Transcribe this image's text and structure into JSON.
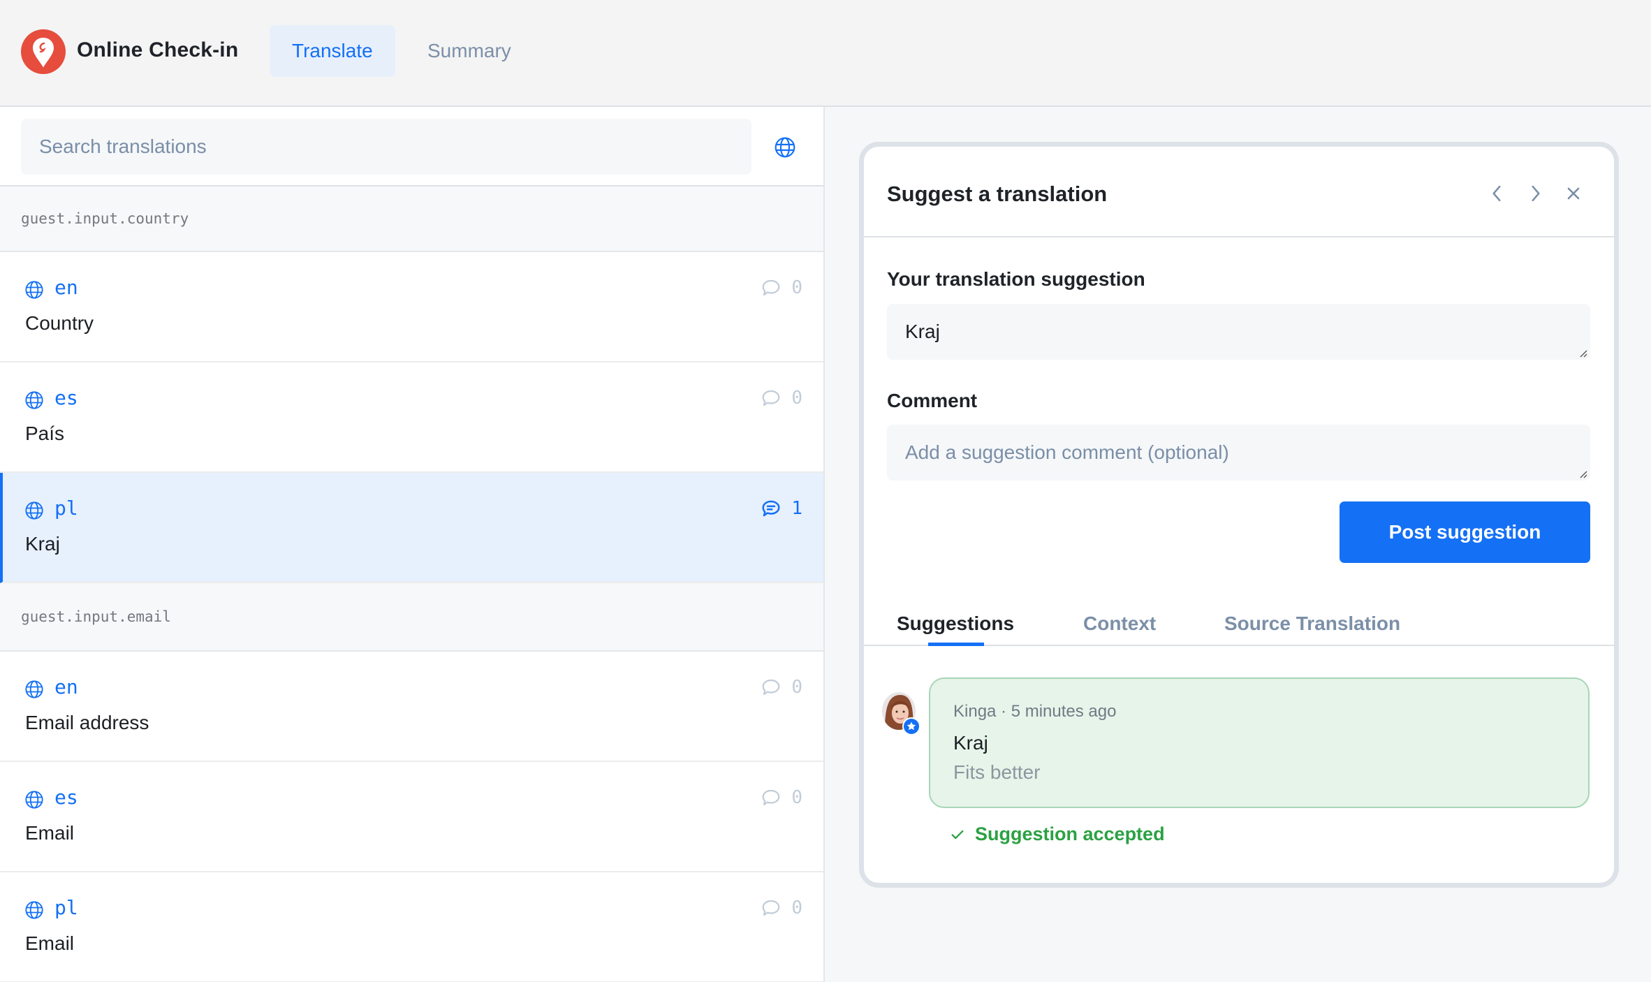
{
  "header": {
    "app_title": "Online Check-in",
    "logo_icon": "map-pin-logo-icon",
    "tabs": [
      {
        "label": "Translate",
        "active": true
      },
      {
        "label": "Summary",
        "active": false
      }
    ]
  },
  "search": {
    "placeholder": "Search translations",
    "value": "",
    "language_filter_icon": "globe-icon"
  },
  "groups": [
    {
      "key": "guest.input.country",
      "rows": [
        {
          "lang": "en",
          "text": "Country",
          "comments": "0",
          "selected": false
        },
        {
          "lang": "es",
          "text": "País",
          "comments": "0",
          "selected": false
        },
        {
          "lang": "pl",
          "text": "Kraj",
          "comments": "1",
          "selected": true
        }
      ]
    },
    {
      "key": "guest.input.email",
      "rows": [
        {
          "lang": "en",
          "text": "Email address",
          "comments": "0",
          "selected": false
        },
        {
          "lang": "es",
          "text": "Email",
          "comments": "0",
          "selected": false
        },
        {
          "lang": "pl",
          "text": "Email",
          "comments": "0",
          "selected": false
        }
      ]
    }
  ],
  "panel": {
    "title": "Suggest a translation",
    "suggestion_label": "Your translation suggestion",
    "suggestion_value": "Kraj",
    "comment_label": "Comment",
    "comment_placeholder": "Add a suggestion comment (optional)",
    "comment_value": "",
    "post_button": "Post suggestion",
    "tabs": [
      {
        "label": "Suggestions",
        "active": true
      },
      {
        "label": "Context",
        "active": false
      },
      {
        "label": "Source Translation",
        "active": false
      }
    ],
    "suggestions": [
      {
        "author": "Kinga",
        "time": "5 minutes ago",
        "meta": "Kinga · 5 minutes ago",
        "text": "Kraj",
        "comment": "Fits better",
        "status": "Suggestion accepted"
      }
    ]
  },
  "colors": {
    "accent": "#1470f5",
    "logo": "#e64d3d",
    "accepted_green": "#2ba143",
    "accepted_bg": "#e6f4ea",
    "selected_row_bg": "#e7f0fd"
  }
}
